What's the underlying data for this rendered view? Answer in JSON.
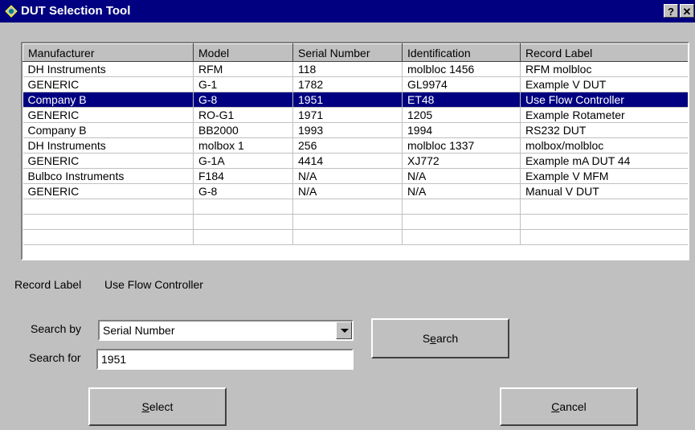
{
  "window": {
    "title": "DUT Selection Tool",
    "help_label": "?",
    "close_label": "✕",
    "title_bar_color": "#000080",
    "selection_color": "#000080"
  },
  "list": {
    "columns": [
      "Manufacturer",
      "Model",
      "Serial Number",
      "Identification",
      "Record Label"
    ],
    "rows": [
      {
        "manufacturer": "DH Instruments",
        "model": "RFM",
        "serial": "118",
        "identification": "molbloc 1456",
        "record_label": "RFM molbloc",
        "selected": false
      },
      {
        "manufacturer": "GENERIC",
        "model": "G-1",
        "serial": "1782",
        "identification": "GL9974",
        "record_label": "Example V DUT",
        "selected": false
      },
      {
        "manufacturer": "Company B",
        "model": "G-8",
        "serial": "1951",
        "identification": "ET48",
        "record_label": "Use Flow Controller",
        "selected": true
      },
      {
        "manufacturer": "GENERIC",
        "model": "RO-G1",
        "serial": "1971",
        "identification": "1205",
        "record_label": "Example Rotameter",
        "selected": false
      },
      {
        "manufacturer": "Company B",
        "model": "BB2000",
        "serial": "1993",
        "identification": "1994",
        "record_label": "RS232 DUT",
        "selected": false
      },
      {
        "manufacturer": "DH Instruments",
        "model": "molbox 1",
        "serial": "256",
        "identification": "molbloc 1337",
        "record_label": "molbox/molbloc",
        "selected": false
      },
      {
        "manufacturer": "GENERIC",
        "model": "G-1A",
        "serial": "4414",
        "identification": "XJ772",
        "record_label": "Example mA DUT 44",
        "selected": false
      },
      {
        "manufacturer": "Bulbco Instruments",
        "model": "F184",
        "serial": "N/A",
        "identification": "N/A",
        "record_label": "Example V MFM",
        "selected": false
      },
      {
        "manufacturer": "GENERIC",
        "model": "G-8",
        "serial": "N/A",
        "identification": "N/A",
        "record_label": "Manual V DUT",
        "selected": false
      },
      {
        "manufacturer": "",
        "model": "",
        "serial": "",
        "identification": "",
        "record_label": "",
        "selected": false
      },
      {
        "manufacturer": "",
        "model": "",
        "serial": "",
        "identification": "",
        "record_label": "",
        "selected": false
      },
      {
        "manufacturer": "",
        "model": "",
        "serial": "",
        "identification": "",
        "record_label": "",
        "selected": false
      }
    ]
  },
  "record_label": {
    "caption": "Record Label",
    "value": "Use Flow Controller"
  },
  "search": {
    "search_by_label": "Search by",
    "search_by_value": "Serial Number",
    "search_for_label": "Search for",
    "search_for_value": "1951",
    "search_button": "Search"
  },
  "actions": {
    "select_label": "Select",
    "cancel_label": "Cancel"
  }
}
